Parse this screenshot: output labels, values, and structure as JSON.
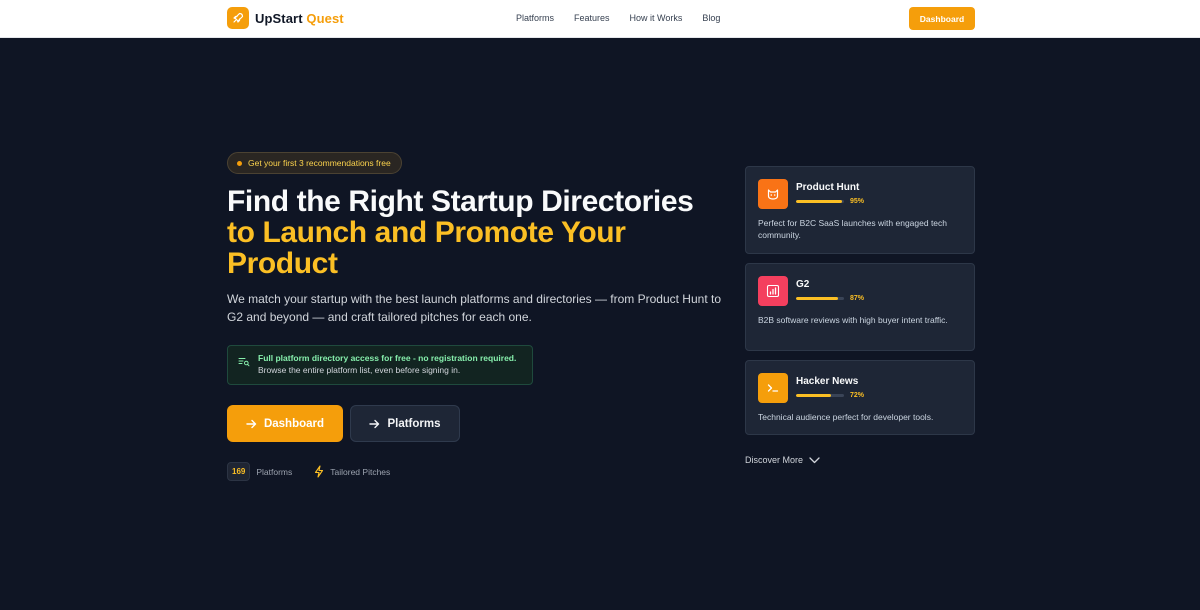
{
  "brand": {
    "name_main": "UpStart",
    "name_accent": "Quest",
    "logo_icon": "rocket-icon",
    "accent_color": "#f59e0b"
  },
  "nav": {
    "links": [
      "Platforms",
      "Features",
      "How it Works",
      "Blog"
    ],
    "cta": "Dashboard"
  },
  "hero": {
    "badge": "Get your first 3 recommendations free",
    "headline_line1": "Find the Right Startup Directories",
    "headline_accent": "to Launch and Promote Your Product",
    "subtitle": "We match your startup with the best launch platforms and directories — from Product Hunt to G2 and beyond — and craft tailored pitches for each one.",
    "notice_title": "Full platform directory access for free - no registration required.",
    "notice_body": "Browse the entire platform list, even before signing in.",
    "primary_button": "Dashboard",
    "secondary_button": "Platforms",
    "platform_count": "169",
    "platform_count_label": "Platforms",
    "pitches_label": "Tailored Pitches"
  },
  "cards": [
    {
      "name": "Product Hunt",
      "score": "95%",
      "score_value": 95,
      "description": "Perfect for B2C SaaS launches with engaged tech community.",
      "icon": "cat-icon",
      "icon_color": "#f97316"
    },
    {
      "name": "G2",
      "score": "87%",
      "score_value": 87,
      "description": "B2B software reviews with high buyer intent traffic.",
      "icon": "bar-chart-icon",
      "icon_color": "#f43f5e"
    },
    {
      "name": "Hacker News",
      "score": "72%",
      "score_value": 72,
      "description": "Technical audience perfect for developer tools.",
      "icon": "terminal-icon",
      "icon_color": "#f59e0b"
    }
  ],
  "discover_more": "Discover More"
}
